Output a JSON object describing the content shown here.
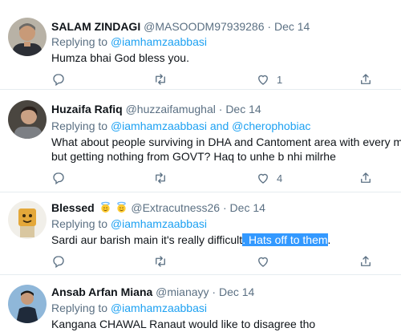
{
  "tweets": [
    {
      "name": "SALAM ZINDAGI",
      "handle": "@MASOODM97939286",
      "date": "Dec 14",
      "replying_label": "Replying to",
      "replying_to": "@iamhamzaabbasi",
      "text": "Humza bhai God bless you.",
      "like_count": "1"
    },
    {
      "name": "Huzaifa Rafiq",
      "handle": "@huzzaifamughal",
      "date": "Dec 14",
      "replying_label": "Replying to",
      "replying_to": "@iamhamzaabbasi and @cherophobiac",
      "text_line1": "What about people surviving in DHA and Cantoment area with every m",
      "text_line2": "but getting nothing from GOVT? Haq to unhe b nhi milrhe",
      "like_count": "4"
    },
    {
      "name": "Blessed",
      "handle": "@Extracutness26",
      "date": "Dec 14",
      "replying_label": "Replying to",
      "replying_to": "@iamhamzaabbasi",
      "text_main": "Sardi aur barish main it's really difficult",
      "text_selected": ". Hats off to them",
      "text_end": "."
    },
    {
      "name": "Ansab Arfan Miana",
      "handle": "@mianayy",
      "date": "Dec 14",
      "replying_label": "Replying to",
      "replying_to": "@iamhamzaabbasi",
      "text": "Kangana CHAWAL Ranaut would like to disagree tho"
    }
  ],
  "separator": "·",
  "icons": [
    "reply-icon",
    "retweet-icon",
    "like-icon",
    "share-icon",
    "halo-emoji-icon"
  ],
  "colors": {
    "link": "#1da1f2",
    "muted": "#5b7083",
    "selection": "#3399ff",
    "divider": "#e6ecf0"
  }
}
